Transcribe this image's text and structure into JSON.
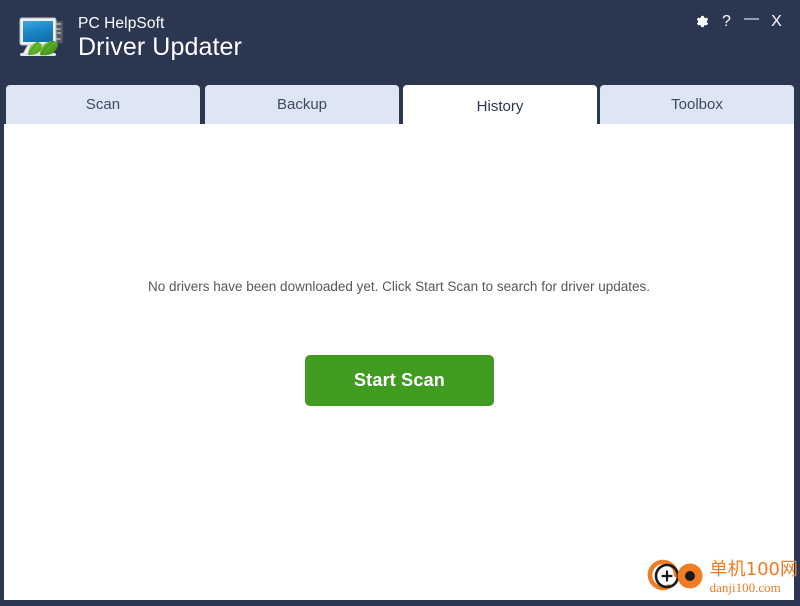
{
  "window": {
    "brand_line1": "PC HelpSoft",
    "brand_line2": "Driver Updater",
    "logo_icon": "monitor-leaf-circuit-logo",
    "chrome_color": "#2b3750",
    "controls": [
      {
        "name": "settings",
        "icon": "gear-icon",
        "glyph": "⚙"
      },
      {
        "name": "help",
        "icon": "question-mark-icon",
        "glyph": "?"
      },
      {
        "name": "minimize",
        "icon": "minimize-icon",
        "glyph": "—"
      },
      {
        "name": "close",
        "icon": "close-icon",
        "glyph": "X"
      }
    ]
  },
  "tabs": [
    {
      "label": "Scan",
      "active": false
    },
    {
      "label": "Backup",
      "active": false
    },
    {
      "label": "History",
      "active": true
    },
    {
      "label": "Toolbox",
      "active": false
    }
  ],
  "content": {
    "empty_message": "No drivers have been downloaded yet.  Click Start Scan to search for driver updates.",
    "start_scan_label": "Start Scan",
    "start_scan_color": "#3f9c21"
  },
  "watermark": {
    "cn_text": "单机100网",
    "url_text": "danji100.com",
    "logo_icon": "danji100-circles-logo",
    "color": "#f07c24"
  }
}
